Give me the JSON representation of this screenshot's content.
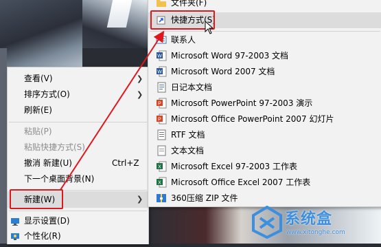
{
  "left_menu": {
    "items": [
      {
        "label": "查看(V)",
        "submenu": true
      },
      {
        "label": "排序方式(O)",
        "submenu": true
      },
      {
        "label": "刷新(E)"
      },
      {
        "label": "粘贴(P)",
        "disabled": true
      },
      {
        "label": "粘贴快捷方式(S)",
        "disabled": true
      },
      {
        "label": "撤消 新建(U)",
        "shortcut": "Ctrl+Z"
      },
      {
        "label": "下一个桌面背景(N)"
      },
      {
        "label": "新建(W)",
        "submenu": true,
        "highlighted": true
      },
      {
        "label": "显示设置(D)",
        "icon": "display-icon"
      },
      {
        "label": "个性化(R)",
        "icon": "personalize-icon"
      }
    ]
  },
  "right_menu": {
    "items": [
      {
        "label": "文件夹(F)",
        "icon": "folder-icon"
      },
      {
        "label": "快捷方式(S)",
        "icon": "shortcut-icon",
        "highlighted": true
      },
      {
        "label": "联系人",
        "icon": "contact-icon"
      },
      {
        "label": "Microsoft Word 97-2003 文档",
        "icon": "word-icon"
      },
      {
        "label": "Microsoft Word 2007 文档",
        "icon": "word-icon"
      },
      {
        "label": "日记本文档",
        "icon": "journal-icon"
      },
      {
        "label": "Microsoft PowerPoint 97-2003 演示",
        "icon": "powerpoint-icon"
      },
      {
        "label": "Microsoft Office PowerPoint 2007 幻灯片",
        "icon": "powerpoint-icon"
      },
      {
        "label": "RTF 文档",
        "icon": "rtf-icon"
      },
      {
        "label": "文本文档",
        "icon": "text-icon"
      },
      {
        "label": "Microsoft Excel 97-2003 工作表",
        "icon": "excel-icon"
      },
      {
        "label": "Microsoft Office Excel 2007 工作表",
        "icon": "excel-icon"
      },
      {
        "label": "360压缩 ZIP 文件",
        "icon": "zip-icon"
      }
    ]
  },
  "watermark": {
    "brand": "系统盒",
    "url": "www.xitonghe.com"
  },
  "colors": {
    "highlight": "#e0161d",
    "menu_bg": "#f2f2f2",
    "word": "#2b5797",
    "excel": "#1e7145",
    "powerpoint": "#d24726",
    "brand": "#3b8fe0"
  }
}
